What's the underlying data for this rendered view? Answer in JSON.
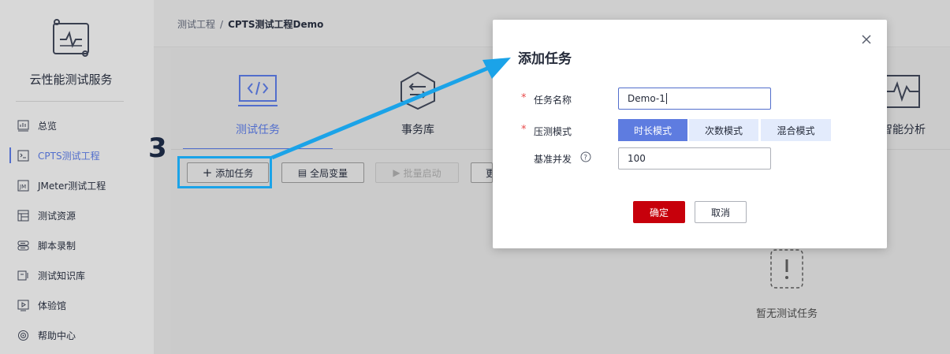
{
  "app": {
    "title": "云性能测试服务"
  },
  "sidebar": {
    "items": [
      {
        "label": "总览",
        "icon": "chart-icon",
        "active": false
      },
      {
        "label": "CPTS测试工程",
        "icon": "terminal-icon",
        "active": true
      },
      {
        "label": "JMeter测试工程",
        "icon": "jmeter-icon",
        "active": false
      },
      {
        "label": "测试资源",
        "icon": "resource-icon",
        "active": false
      },
      {
        "label": "脚本录制",
        "icon": "record-icon",
        "active": false
      },
      {
        "label": "测试知识库",
        "icon": "knowledge-icon",
        "active": false
      },
      {
        "label": "体验馆",
        "icon": "play-icon",
        "active": false
      },
      {
        "label": "帮助中心",
        "icon": "target-icon",
        "active": false
      }
    ]
  },
  "breadcrumb": {
    "parent": "测试工程",
    "separator": "/",
    "current": "CPTS测试工程Demo"
  },
  "tabs": [
    {
      "label": "测试任务",
      "icon": "code-icon",
      "active": true
    },
    {
      "label": "事务库",
      "icon": "transaction-icon",
      "active": false
    },
    {
      "label": "智能分析",
      "icon": "pulse-icon",
      "active": false
    }
  ],
  "toolbar": {
    "add_task": "添加任务",
    "global_vars": "全局变量",
    "batch_start": "批量启动",
    "more": "更"
  },
  "empty": {
    "text": "暂无测试任务"
  },
  "modal": {
    "title": "添加任务",
    "name_label": "任务名称",
    "name_value": "Demo-1",
    "mode_label": "压测模式",
    "modes": [
      "时长模式",
      "次数模式",
      "混合模式"
    ],
    "selected_mode": "时长模式",
    "concurrency_label": "基准并发",
    "concurrency_value": "100",
    "confirm": "确定",
    "cancel": "取消",
    "required_mark": "*"
  },
  "annotation": {
    "step": "3",
    "color": "#1ba3e8"
  },
  "colors": {
    "accent": "#526ecc",
    "primary_button": "#c7000b",
    "segment_on": "#5e7ce0"
  }
}
